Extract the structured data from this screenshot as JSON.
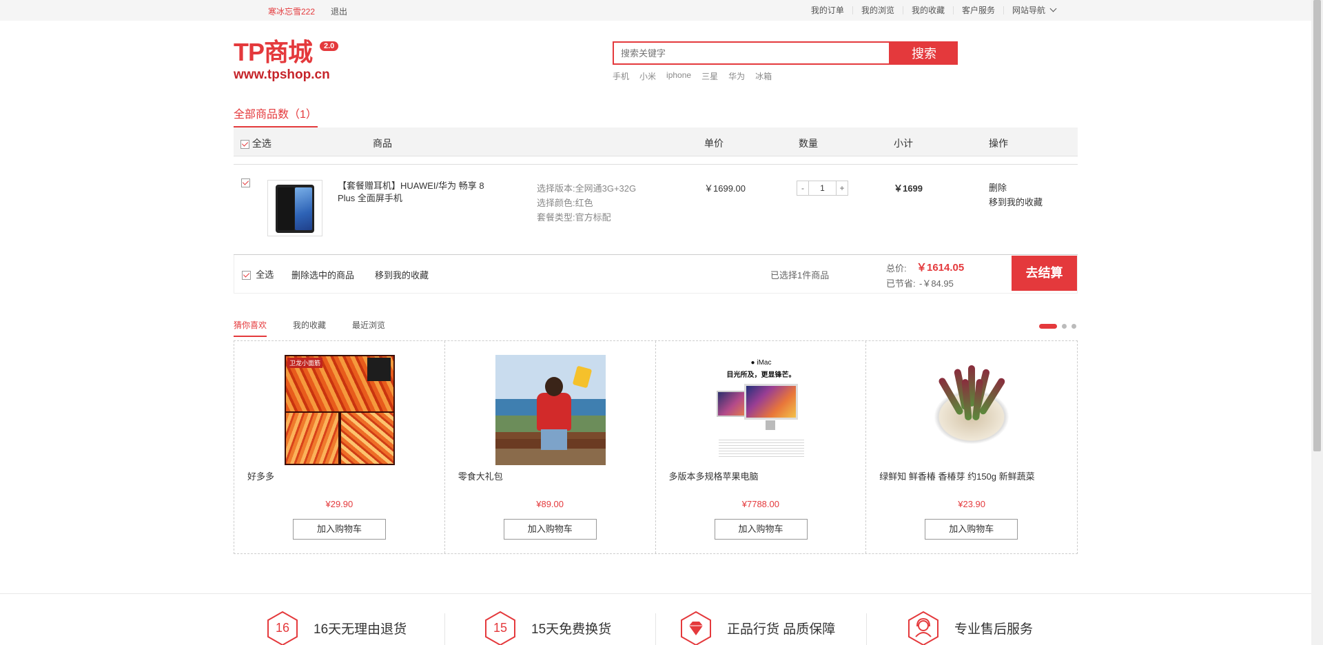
{
  "topbar": {
    "username": "寒冰忘雪222",
    "logout": "退出",
    "links": [
      "我的订单",
      "我的浏览",
      "我的收藏",
      "客户服务",
      "网站导航"
    ]
  },
  "header": {
    "logo_text": "TP商城",
    "logo_version": "2.0",
    "logo_url": "www.tpshop.cn",
    "search_placeholder": "搜索关键字",
    "search_button": "搜索",
    "hot_words": [
      "手机",
      "小米",
      "iphone",
      "三星",
      "华为",
      "冰箱"
    ]
  },
  "cart": {
    "title": "全部商品数（1）",
    "columns": {
      "select_all": "全选",
      "product": "商品",
      "unit_price": "单价",
      "quantity": "数量",
      "subtotal": "小计",
      "operation": "操作"
    },
    "items": [
      {
        "name": "【套餐赠耳机】HUAWEI/华为 畅享 8 Plus 全面屏手机",
        "spec_version": "选择版本:全网通3G+32G",
        "spec_color": "选择颜色:红色",
        "spec_package": "套餐类型:官方标配",
        "unit_price": "￥1699.00",
        "quantity_minus": "-",
        "quantity": "1",
        "quantity_plus": "+",
        "subtotal": "￥1699",
        "delete": "删除",
        "move_to_fav": "移到我的收藏"
      }
    ],
    "footer": {
      "select_all": "全选",
      "delete_selected": "删除选中的商品",
      "move_to_fav": "移到我的收藏",
      "selected_count": "已选择1件商品",
      "total_label": "总价:",
      "total_value": "￥1614.05",
      "saved_label": "已节省:",
      "saved_value": "-￥84.95",
      "checkout": "去结算"
    }
  },
  "recommend": {
    "tabs": [
      "猜你喜欢",
      "我的收藏",
      "最近浏览"
    ],
    "active_tab": 0,
    "products": [
      {
        "name": "好多多",
        "price": "¥29.90",
        "button": "加入购物车",
        "image_tag": "卫龙小面筋"
      },
      {
        "name": "零食大礼包",
        "price": "¥89.00",
        "button": "加入购物车"
      },
      {
        "name": "多版本多规格苹果电脑",
        "price": "¥7788.00",
        "button": "加入购物车",
        "image_line1": "iMac",
        "image_line2": "目光所及，更显锋芒。"
      },
      {
        "name": "绿鲜知 鲜香椿 香椿芽 约150g 新鲜蔬菜",
        "price": "¥23.90",
        "button": "加入购物车"
      }
    ]
  },
  "services": [
    {
      "icon": "16",
      "label": "16天无理由退货"
    },
    {
      "icon": "15",
      "label": "15天免费换货"
    },
    {
      "icon": "diamond-icon",
      "label": "正品行货 品质保障"
    },
    {
      "icon": "service-person-icon",
      "label": "专业售后服务"
    }
  ],
  "colors": {
    "accent": "#e4393c",
    "topbar_bg": "#f5f5f5"
  }
}
